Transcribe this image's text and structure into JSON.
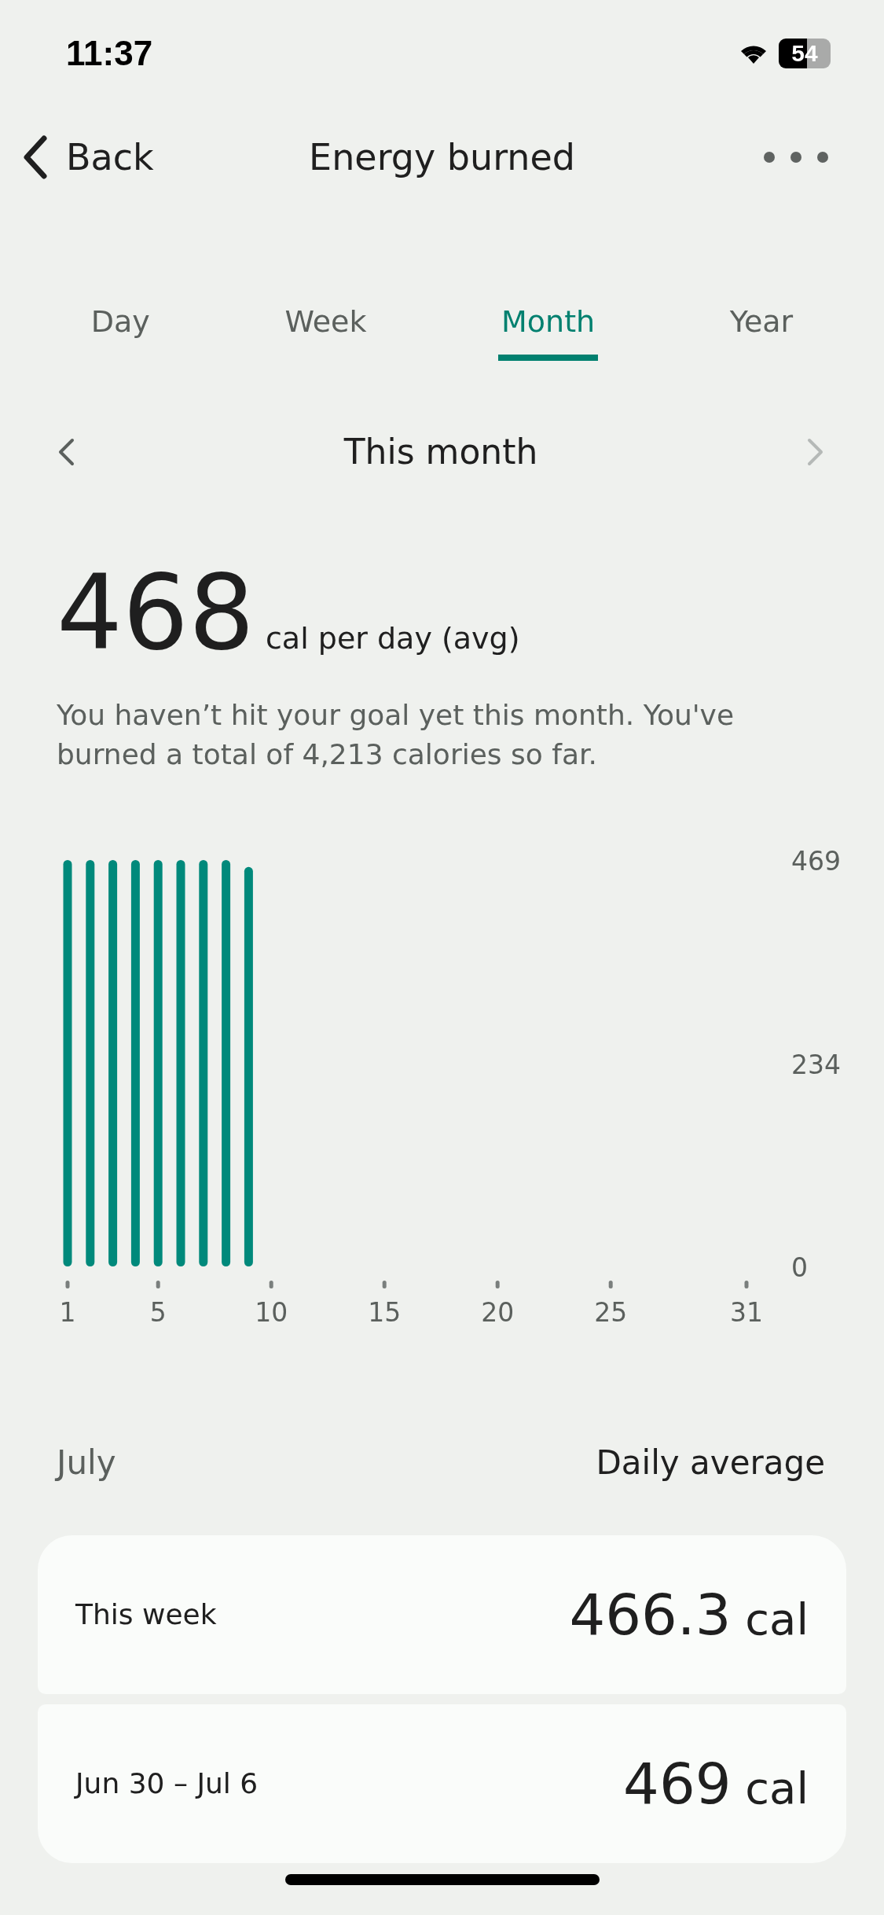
{
  "status_bar": {
    "time": "11:37",
    "battery": "54"
  },
  "header": {
    "back": "Back",
    "title": "Energy burned"
  },
  "tabs": [
    {
      "label": "Day",
      "selected": false
    },
    {
      "label": "Week",
      "selected": false
    },
    {
      "label": "Month",
      "selected": true
    },
    {
      "label": "Year",
      "selected": false
    }
  ],
  "period": {
    "label": "This month",
    "prev_disabled": false,
    "next_disabled": true
  },
  "summary": {
    "value": "468",
    "unit": "cal per day (avg)",
    "message": "You haven’t hit your goal yet this month. You've burned a total of 4,213 calories so far."
  },
  "chart": {
    "chart_data": {
      "type": "bar",
      "x": [
        1,
        2,
        3,
        4,
        5,
        6,
        7,
        8,
        9
      ],
      "series": [
        {
          "color": "#00897b",
          "values": [
            469,
            469,
            469,
            469,
            469,
            469,
            469,
            469,
            461
          ]
        }
      ],
      "xlim": [
        1,
        31
      ],
      "ylim": [
        0,
        469
      ],
      "xticks": [
        1,
        5,
        10,
        15,
        20,
        25,
        31
      ],
      "yticks": [
        0,
        234,
        469
      ]
    }
  },
  "section": {
    "label": "July",
    "heading": "Daily average"
  },
  "rows": [
    {
      "label": "This week",
      "value": "466.3",
      "unit": "cal"
    },
    {
      "label": "Jun 30 – Jul 6",
      "value": "469",
      "unit": "cal"
    }
  ]
}
